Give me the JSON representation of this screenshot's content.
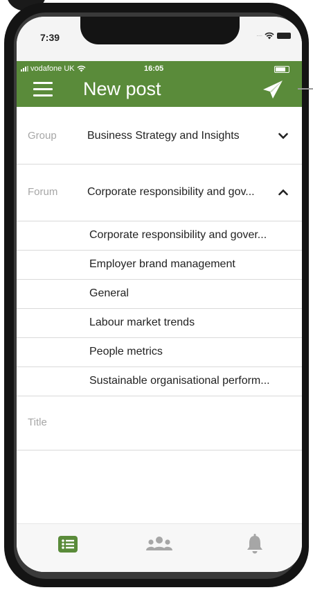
{
  "device": {
    "ios_time": "7:39"
  },
  "inner_status": {
    "carrier": "vodafone UK",
    "time": "16:05"
  },
  "header": {
    "title": "New post",
    "menu_icon": "hamburger-menu-icon",
    "send_icon": "paper-plane-icon"
  },
  "form": {
    "group": {
      "label": "Group",
      "value": "Business Strategy and Insights",
      "chevron": "chevron-down-icon"
    },
    "forum": {
      "label": "Forum",
      "value": "Corporate responsibility and gov...",
      "chevron": "chevron-up-icon"
    },
    "forum_options": [
      "Corporate responsibility and gover...",
      "Employer brand management",
      "General",
      "Labour market trends",
      "People metrics",
      "Sustainable organisational perform..."
    ],
    "title": {
      "placeholder": "Title"
    }
  },
  "tabs": [
    {
      "name": "list-icon",
      "active": true
    },
    {
      "name": "people-icon",
      "active": false
    },
    {
      "name": "bell-icon",
      "active": false
    }
  ],
  "colors": {
    "brand_green": "#5a8b3a",
    "active_tab": "#5a8b3a",
    "inactive_tab": "#a6a6a6"
  }
}
